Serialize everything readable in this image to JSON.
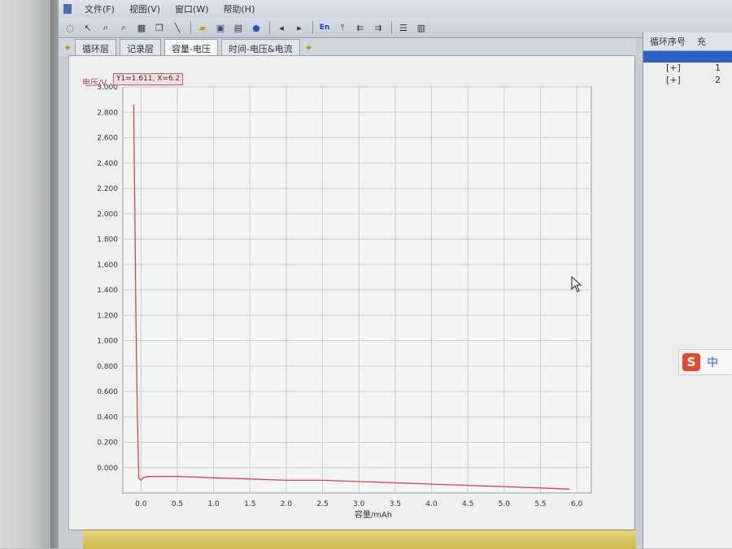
{
  "menu": {
    "items": [
      "文件(F)",
      "视图(V)",
      "窗口(W)",
      "帮助(H)"
    ]
  },
  "toolbar": {
    "icons": [
      "pointer-icon",
      "select-icon",
      "zoom-icon",
      "zoom-out-icon",
      "table-icon",
      "copy-icon",
      "line-icon",
      "open-folder-icon",
      "save-icon",
      "print-icon",
      "help-icon",
      "prev-icon",
      "next-icon",
      "language-en-icon",
      "pin-icon",
      "align-left-icon",
      "align-right-icon",
      "list-icon",
      "grid-icon"
    ],
    "language_label": "En"
  },
  "tabs": [
    {
      "label": "循环层",
      "active": false
    },
    {
      "label": "记录层",
      "active": false
    },
    {
      "label": "容量-电压",
      "active": true
    },
    {
      "label": "时间-电压&电流",
      "active": false
    }
  ],
  "readout": {
    "text": "Y1=1.611, X=6.2"
  },
  "right_panel": {
    "col1_header": "循环序号",
    "col2_header": "充",
    "rows": [
      {
        "c1": "[+]",
        "c2": "1"
      },
      {
        "c1": "[+]",
        "c2": "2"
      }
    ]
  },
  "ime": {
    "label": "中"
  },
  "colors": {
    "series": "#e04050",
    "grid": "#c9cccc",
    "plot_bg": "#f3f4f4"
  },
  "chart_data": {
    "type": "line",
    "title": "",
    "xlabel": "容量/mAh",
    "ylabel": "电压/V",
    "xlim": [
      -0.25,
      6.2
    ],
    "ylim": [
      -0.2,
      3.0
    ],
    "xticks": [
      "0.0",
      "0.5",
      "1.0",
      "1.5",
      "2.0",
      "2.5",
      "3.0",
      "3.5",
      "4.0",
      "4.5",
      "5.0",
      "5.5",
      "6.0"
    ],
    "yticks": [
      "0.000",
      "0.200",
      "0.400",
      "0.600",
      "0.800",
      "1.000",
      "1.200",
      "1.400",
      "1.600",
      "1.800",
      "2.000",
      "2.200",
      "2.400",
      "2.600",
      "2.800",
      "3.000"
    ],
    "grid": true,
    "series": [
      {
        "color": "#e04050",
        "x": [
          -0.1,
          -0.09,
          -0.07,
          -0.05,
          -0.03,
          0.0,
          0.03,
          0.1,
          0.5,
          1.0,
          1.5,
          2.0,
          2.5,
          3.0,
          3.5,
          4.0,
          4.5,
          5.0,
          5.5,
          5.9
        ],
        "y": [
          2.86,
          2.3,
          1.2,
          0.4,
          -0.08,
          -0.1,
          -0.08,
          -0.07,
          -0.07,
          -0.08,
          -0.09,
          -0.1,
          -0.1,
          -0.11,
          -0.12,
          -0.13,
          -0.14,
          -0.15,
          -0.16,
          -0.17
        ]
      }
    ]
  }
}
